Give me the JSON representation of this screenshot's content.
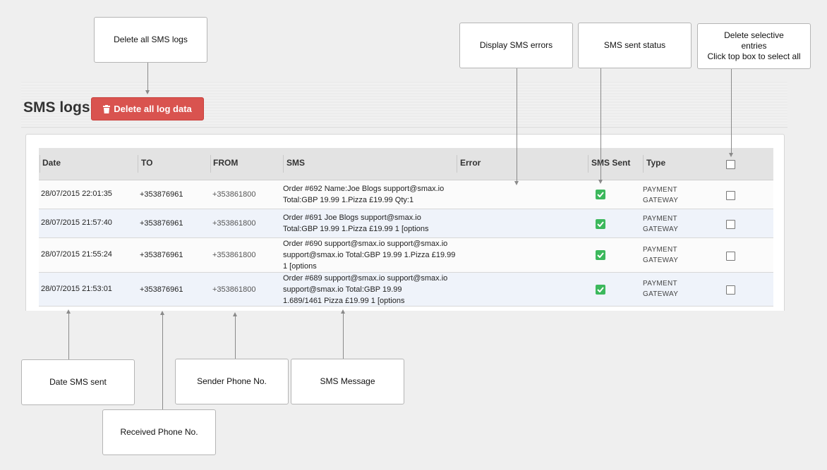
{
  "page": {
    "title": "SMS logs",
    "delete_all_button": "Delete all log data"
  },
  "table": {
    "headers": {
      "date": "Date",
      "to": "TO",
      "from": "FROM",
      "sms": "SMS",
      "error": "Error",
      "sent": "SMS Sent",
      "type": "Type"
    },
    "rows": [
      {
        "date": "28/07/2015 22:01:35",
        "to": "+353876961",
        "from": "+353861800",
        "sms": [
          "Order #692 Name:Joe Blogs support@smax.io",
          "Total:GBP 19.99 1.Pizza £19.99 Qty:1"
        ],
        "error": "",
        "sent": true,
        "type": [
          "PAYMENT",
          "GATEWAY"
        ],
        "selected": false
      },
      {
        "date": "28/07/2015 21:57:40",
        "to": "+353876961",
        "from": "+353861800",
        "sms": [
          "Order #691 Joe Blogs support@smax.io",
          "Total:GBP 19.99 1.Pizza £19.99 1 [options"
        ],
        "error": "",
        "sent": true,
        "type": [
          "PAYMENT",
          "GATEWAY"
        ],
        "selected": false
      },
      {
        "date": "28/07/2015 21:55:24",
        "to": "+353876961",
        "from": "+353861800",
        "sms": [
          "Order #690 support@smax.io support@smax.io",
          "support@smax.io Total:GBP 19.99 1.Pizza £19.99",
          "1 [options"
        ],
        "error": "",
        "sent": true,
        "type": [
          "PAYMENT",
          "GATEWAY"
        ],
        "selected": false
      },
      {
        "date": "28/07/2015 21:53:01",
        "to": "+353876961",
        "from": "+353861800",
        "sms": [
          "Order #689 support@smax.io support@smax.io",
          "support@smax.io Total:GBP 19.99",
          "1.689/1461 Pizza £19.99 1 [options"
        ],
        "error": "",
        "sent": true,
        "type": [
          "PAYMENT",
          "GATEWAY"
        ],
        "selected": false
      }
    ]
  },
  "callouts": {
    "delete_all": "Delete all SMS logs",
    "errors": "Display SMS errors",
    "sent_status": "SMS sent status",
    "delete_selective": [
      "Delete selective",
      "entries",
      "Click top box to select all"
    ],
    "date": "Date SMS sent",
    "received": "Received Phone No.",
    "sender": "Sender Phone No.",
    "message": "SMS Message"
  },
  "colors": {
    "danger": "#d9534f",
    "success": "#3cb85c",
    "row_alt": "#eff3fa"
  },
  "icons": [
    "trash-icon",
    "check-icon"
  ]
}
